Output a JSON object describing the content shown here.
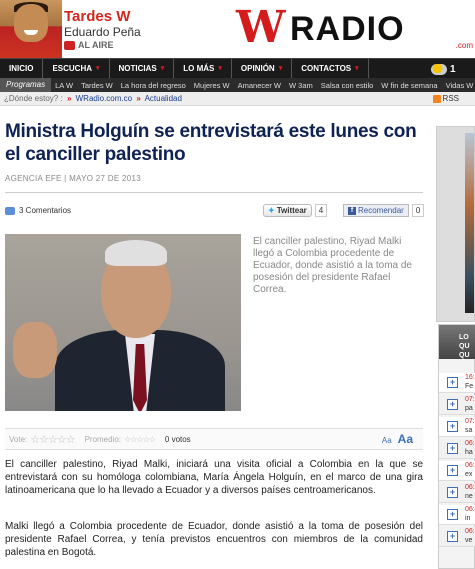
{
  "header": {
    "show_title": "Tardes W",
    "show_host": "Eduardo Peña",
    "on_air": "AL AIRE",
    "logo_w": "W",
    "logo_radio": "RADIO",
    "logo_domain": ".com"
  },
  "nav": {
    "items": [
      "INICIO",
      "ESCUCHA",
      "NOTICIAS",
      "LO MÁS",
      "OPINIÓN",
      "CONTACTOS"
    ],
    "weather_temp": "1"
  },
  "subnav": {
    "label": "Programas",
    "items": [
      "LA W",
      "Tardes W",
      "La hora del regreso",
      "Mujeres W",
      "Amanecer W",
      "W 3am",
      "Salsa con estilo",
      "W fin de semana",
      "Vidas W"
    ]
  },
  "breadcrumb": {
    "where": "¿Dónde estoy? :",
    "home": "WRadio.com.co",
    "section": "Actualidad",
    "rss": "RSS"
  },
  "article": {
    "headline": "Ministra Holguín se entrevistará este lunes con el canciller palestino",
    "byline": "AGENCIA EFE | MAYO 27 DE 2013",
    "comments": "3 Comentarios",
    "twitter_label": "Twittear",
    "twitter_count": "4",
    "facebook_label": "Recomendar",
    "facebook_count": "0",
    "caption": "El canciller palestino, Riyad Malki llegó a Colombia procedente de Ecuador, donde asistió a la toma de posesión del presidente Rafael Correa.",
    "vote_label": "Vote:",
    "average_label": "Promedio:",
    "votes": "0 votos",
    "text_small": "Aa",
    "text_large": "Aa",
    "paragraph1": "El canciller palestino, Riyad Malki, iniciará una visita oficial a Colombia en la que se entrevistará con su homóloga colombiana, María Ángela Holguín, en el marco de una gira latinoamericana que lo ha llevado a Ecuador y a diversos países centroamericanos.",
    "paragraph2": "Malki llegó a Colombia procedente de Ecuador, donde asistió a la toma de posesión del presidente Rafael Correa, y tenía previstos encuentros con miembros de la comunidad palestina en Bogotá."
  },
  "sidebar": {
    "box_title_1": "LO QU",
    "box_title_2": "QU",
    "items": [
      {
        "time": "16:",
        "text": "Fe"
      },
      {
        "time": "07:",
        "text": "pa"
      },
      {
        "time": "07:",
        "text": "sa"
      },
      {
        "time": "06:",
        "text": "ha"
      },
      {
        "time": "06:",
        "text": "ex"
      },
      {
        "time": "06:",
        "text": "ne"
      },
      {
        "time": "06:",
        "text": "in"
      },
      {
        "time": "06:",
        "text": "ve"
      }
    ]
  }
}
